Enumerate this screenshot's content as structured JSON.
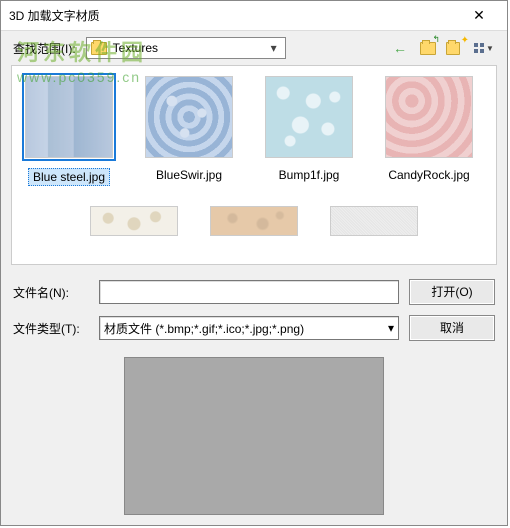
{
  "titlebar": {
    "title": "3D 加载文字材质",
    "close": "✕"
  },
  "toolbar": {
    "scope_label": "查找范围(I):",
    "folder": "Textures",
    "back_icon": "arrow-left",
    "up_icon": "folder-up",
    "new_folder_icon": "folder-new",
    "view_icon": "view-grid"
  },
  "thumbnails": [
    {
      "name": "Blue steel.jpg",
      "class": "bluesteel",
      "selected": true
    },
    {
      "name": "BlueSwir.jpg",
      "class": "blueswirl",
      "selected": false
    },
    {
      "name": "Bump1f.jpg",
      "class": "bump",
      "selected": false
    },
    {
      "name": "CandyRock.jpg",
      "class": "candy",
      "selected": false
    }
  ],
  "partial_row": [
    {
      "class": "leopard"
    },
    {
      "class": "sand"
    },
    {
      "class": "noise"
    }
  ],
  "form": {
    "filename_label": "文件名(N):",
    "filename_value": "",
    "filetype_label": "文件类型(T):",
    "filetype_value": "材质文件 (*.bmp;*.gif;*.ico;*.jpg;*.png)",
    "open_label": "打开(O)",
    "cancel_label": "取消"
  },
  "watermark": {
    "main": "河东软件园",
    "sub": "www.pc0359.cn"
  }
}
